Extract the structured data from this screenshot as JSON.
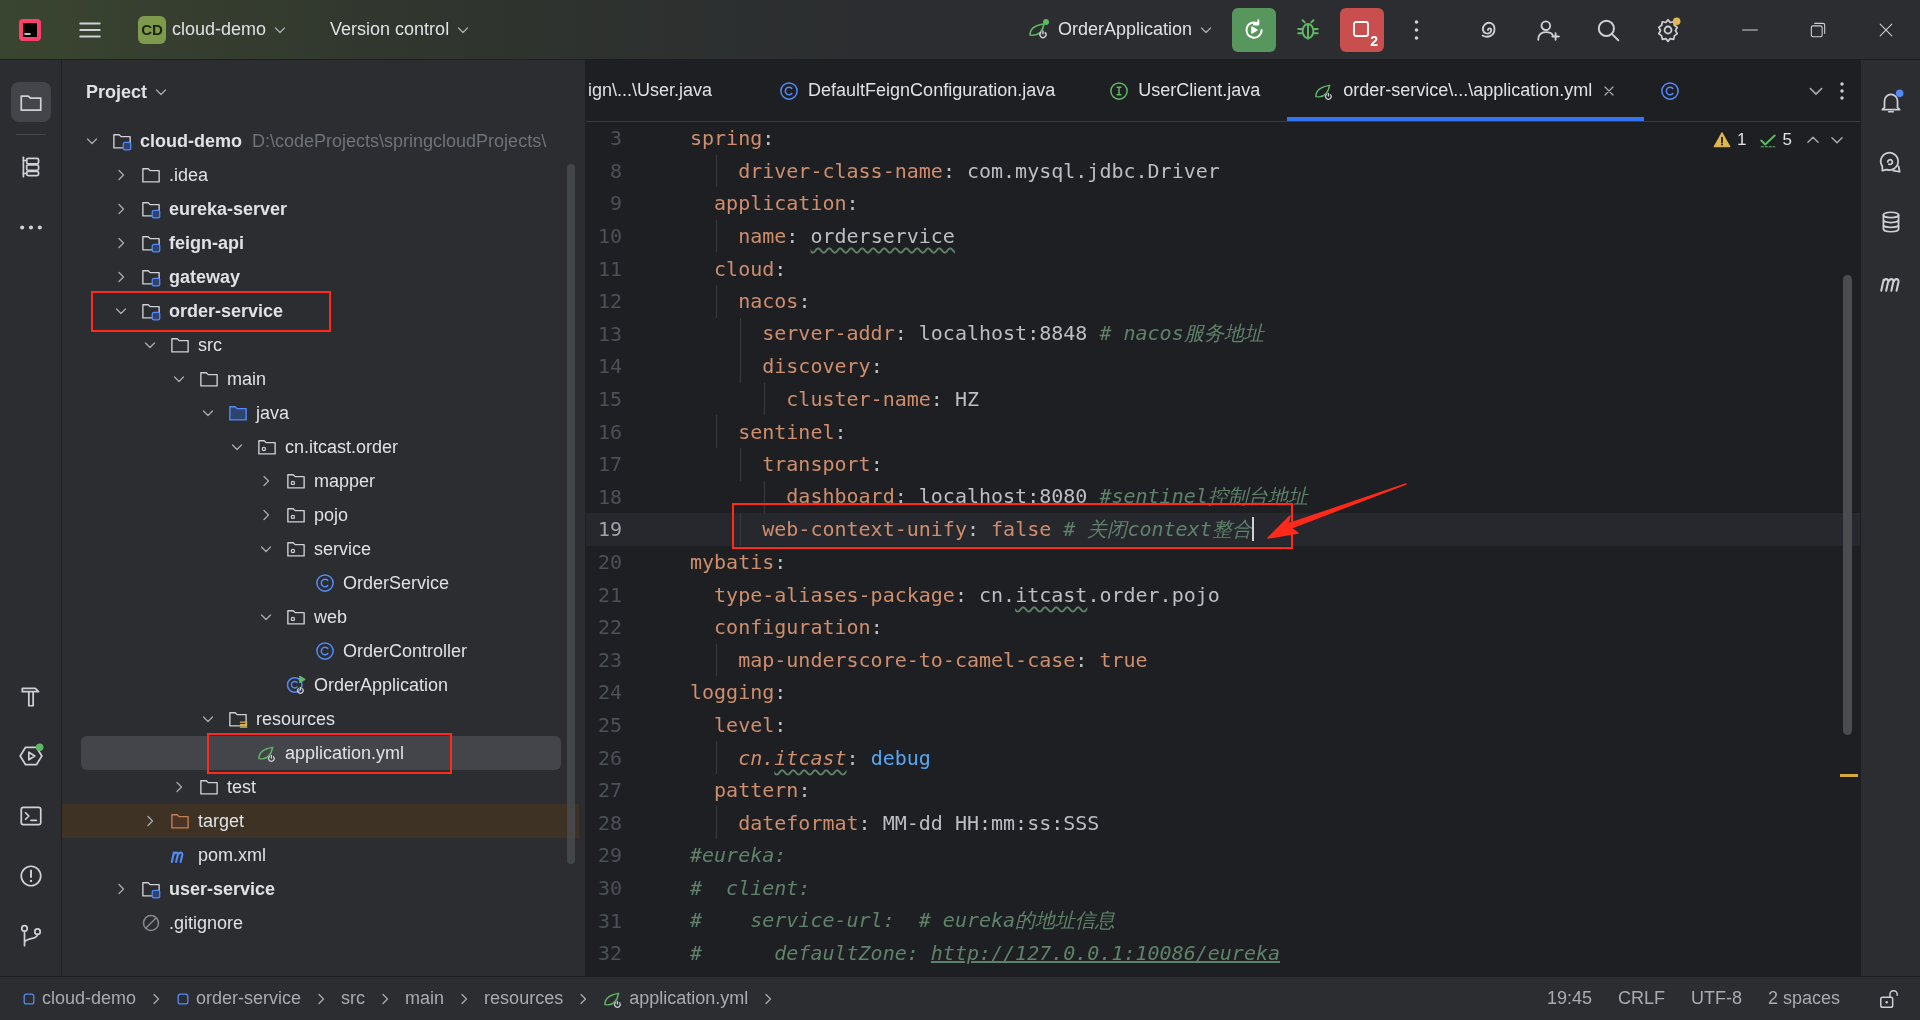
{
  "title_bar": {
    "project_badge": "CD",
    "project": "cloud-demo",
    "vcs": "Version control",
    "run_config": "OrderApplication",
    "stop_badge": "2",
    "settings_update": true
  },
  "left_toolbar": {
    "top": [
      {
        "kind": "project",
        "selected": true,
        "notify": false
      },
      {
        "kind": "structure",
        "selected": false,
        "notify": false
      },
      {
        "kind": "more",
        "selected": false,
        "notify": false
      }
    ],
    "bottom": [
      {
        "kind": "build",
        "selected": false,
        "notify": false
      },
      {
        "kind": "services",
        "selected": false,
        "notify": true
      },
      {
        "kind": "terminal",
        "selected": false,
        "notify": false
      },
      {
        "kind": "problems",
        "selected": false,
        "notify": false
      },
      {
        "kind": "git",
        "selected": false,
        "notify": false
      }
    ]
  },
  "project_panel": {
    "title": "Project",
    "tree": [
      {
        "label": "cloud-demo",
        "kind": "module",
        "bold": true,
        "path": "D:\\codeProjects\\springcloudProjects\\",
        "expanded": true,
        "selected": false,
        "annotated": false,
        "children": [
          {
            "label": ".idea",
            "kind": "folder",
            "bold": false,
            "expanded": false,
            "selected": false,
            "annotated": false
          },
          {
            "label": "eureka-server",
            "kind": "module",
            "bold": true,
            "expanded": false,
            "selected": false,
            "annotated": false
          },
          {
            "label": "feign-api",
            "kind": "module",
            "bold": true,
            "expanded": false,
            "selected": false,
            "annotated": false
          },
          {
            "label": "gateway",
            "kind": "module",
            "bold": true,
            "expanded": false,
            "selected": false,
            "annotated": false
          },
          {
            "label": "order-service",
            "kind": "module",
            "bold": true,
            "expanded": true,
            "selected": false,
            "annotated": true,
            "children": [
              {
                "label": "src",
                "kind": "folder",
                "bold": false,
                "expanded": true,
                "selected": false,
                "annotated": false,
                "children": [
                  {
                    "label": "main",
                    "kind": "folder",
                    "bold": false,
                    "expanded": true,
                    "selected": false,
                    "annotated": false,
                    "children": [
                      {
                        "label": "java",
                        "kind": "source",
                        "bold": false,
                        "expanded": true,
                        "selected": false,
                        "annotated": false,
                        "children": [
                          {
                            "label": "cn.itcast.order",
                            "kind": "package",
                            "bold": false,
                            "expanded": true,
                            "selected": false,
                            "annotated": false,
                            "children": [
                              {
                                "label": "mapper",
                                "kind": "package",
                                "bold": false,
                                "expanded": false,
                                "selected": false,
                                "annotated": false
                              },
                              {
                                "label": "pojo",
                                "kind": "package",
                                "bold": false,
                                "expanded": false,
                                "selected": false,
                                "annotated": false
                              },
                              {
                                "label": "service",
                                "kind": "package",
                                "bold": false,
                                "expanded": true,
                                "selected": false,
                                "annotated": false,
                                "children": [
                                  {
                                    "label": "OrderService",
                                    "kind": "class",
                                    "bold": false,
                                    "selected": false,
                                    "annotated": false
                                  }
                                ]
                              },
                              {
                                "label": "web",
                                "kind": "package",
                                "bold": false,
                                "expanded": true,
                                "selected": false,
                                "annotated": false,
                                "children": [
                                  {
                                    "label": "OrderController",
                                    "kind": "class",
                                    "bold": false,
                                    "selected": false,
                                    "annotated": false
                                  }
                                ]
                              },
                              {
                                "label": "OrderApplication",
                                "kind": "spring-class",
                                "bold": false,
                                "selected": false,
                                "annotated": false
                              }
                            ]
                          }
                        ]
                      },
                      {
                        "label": "resources",
                        "kind": "resources",
                        "bold": false,
                        "expanded": true,
                        "selected": false,
                        "annotated": false,
                        "children": [
                          {
                            "label": "application.yml",
                            "kind": "spring-config",
                            "bold": false,
                            "selected": true,
                            "annotated": true
                          }
                        ]
                      }
                    ]
                  },
                  {
                    "label": "test",
                    "kind": "folder",
                    "bold": false,
                    "expanded": false,
                    "selected": false,
                    "annotated": false
                  }
                ]
              },
              {
                "label": "target",
                "kind": "excluded",
                "bold": false,
                "expanded": false,
                "selected": false,
                "annotated": false
              },
              {
                "label": "pom.xml",
                "kind": "maven",
                "bold": false,
                "selected": false,
                "annotated": false
              }
            ]
          },
          {
            "label": "user-service",
            "kind": "module",
            "bold": true,
            "expanded": false,
            "selected": false,
            "annotated": false
          },
          {
            "label": ".gitignore",
            "kind": "ignore",
            "bold": false,
            "selected": false,
            "annotated": false
          }
        ]
      }
    ]
  },
  "editor": {
    "tabs": [
      {
        "label": "ign\\...\\User.java",
        "kind": "plain",
        "selected": false,
        "closable": false
      },
      {
        "label": "DefaultFeignConfiguration.java",
        "kind": "class",
        "selected": false,
        "closable": false
      },
      {
        "label": "UserClient.java",
        "kind": "interface",
        "selected": false,
        "closable": false
      },
      {
        "label": "order-service\\...\\application.yml",
        "kind": "spring-config",
        "selected": true,
        "closable": true
      },
      {
        "kind": "class",
        "selected": false,
        "closable": false
      }
    ],
    "inspections": {
      "warnings": "1",
      "passed": "5"
    },
    "lines": [
      {
        "number": "3",
        "current": false,
        "annotated": false,
        "segments": [
          {
            "kind": "key",
            "text": "spring"
          },
          {
            "kind": "plain",
            "text": ":"
          }
        ]
      },
      {
        "number": "8",
        "current": false,
        "annotated": false,
        "segments": [
          {
            "kind": "key",
            "text": "    driver-class-name"
          },
          {
            "kind": "plain",
            "text": ": com.mysql.jdbc.Driver"
          }
        ]
      },
      {
        "number": "9",
        "current": false,
        "annotated": false,
        "segments": [
          {
            "kind": "key",
            "text": "  application"
          },
          {
            "kind": "plain",
            "text": ":"
          }
        ]
      },
      {
        "number": "10",
        "current": false,
        "annotated": false,
        "segments": [
          {
            "kind": "key",
            "text": "    name"
          },
          {
            "kind": "plain",
            "text": ": "
          },
          {
            "kind": "plain",
            "text": "orderservice",
            "typo": true
          }
        ]
      },
      {
        "number": "11",
        "current": false,
        "annotated": false,
        "segments": [
          {
            "kind": "key",
            "text": "  cloud"
          },
          {
            "kind": "plain",
            "text": ":"
          }
        ]
      },
      {
        "number": "12",
        "current": false,
        "annotated": false,
        "segments": [
          {
            "kind": "key",
            "text": "    nacos"
          },
          {
            "kind": "plain",
            "text": ":"
          }
        ]
      },
      {
        "number": "13",
        "current": false,
        "annotated": false,
        "segments": [
          {
            "kind": "key",
            "text": "      server-addr"
          },
          {
            "kind": "plain",
            "text": ": localhost:8848 "
          },
          {
            "kind": "comment",
            "text": "# nacos服务地址"
          }
        ]
      },
      {
        "number": "14",
        "current": false,
        "annotated": false,
        "segments": [
          {
            "kind": "key",
            "text": "      discovery"
          },
          {
            "kind": "plain",
            "text": ":"
          }
        ]
      },
      {
        "number": "15",
        "current": false,
        "annotated": false,
        "segments": [
          {
            "kind": "key",
            "text": "        cluster-name"
          },
          {
            "kind": "plain",
            "text": ": HZ"
          }
        ]
      },
      {
        "number": "16",
        "current": false,
        "annotated": false,
        "segments": [
          {
            "kind": "key",
            "text": "    sentinel"
          },
          {
            "kind": "plain",
            "text": ":"
          }
        ]
      },
      {
        "number": "17",
        "current": false,
        "annotated": false,
        "segments": [
          {
            "kind": "key",
            "text": "      transport"
          },
          {
            "kind": "plain",
            "text": ":"
          }
        ]
      },
      {
        "number": "18",
        "current": false,
        "annotated": false,
        "segments": [
          {
            "kind": "key",
            "text": "        dashboard"
          },
          {
            "kind": "plain",
            "text": ": localhost:8080 "
          },
          {
            "kind": "comment",
            "text": "#sentinel控制台地址"
          }
        ]
      },
      {
        "number": "19",
        "current": true,
        "annotated": true,
        "segments": [
          {
            "kind": "key",
            "text": "      web-context-unify"
          },
          {
            "kind": "plain",
            "text": ": "
          },
          {
            "kind": "bool",
            "text": "false"
          },
          {
            "kind": "comment",
            "text": " # 关闭context整合"
          }
        ]
      },
      {
        "number": "20",
        "current": false,
        "annotated": false,
        "segments": [
          {
            "kind": "key",
            "text": "mybatis"
          },
          {
            "kind": "plain",
            "text": ":"
          }
        ]
      },
      {
        "number": "21",
        "current": false,
        "annotated": false,
        "segments": [
          {
            "kind": "key",
            "text": "  type-aliases-package"
          },
          {
            "kind": "plain",
            "text": ": cn."
          },
          {
            "kind": "plain",
            "text": "itcast",
            "typo": true
          },
          {
            "kind": "plain",
            "text": ".order.pojo"
          }
        ]
      },
      {
        "number": "22",
        "current": false,
        "annotated": false,
        "segments": [
          {
            "kind": "key",
            "text": "  configuration"
          },
          {
            "kind": "plain",
            "text": ":"
          }
        ]
      },
      {
        "number": "23",
        "current": false,
        "annotated": false,
        "segments": [
          {
            "kind": "key",
            "text": "    map-underscore-to-camel-case"
          },
          {
            "kind": "plain",
            "text": ": "
          },
          {
            "kind": "bool",
            "text": "true"
          }
        ]
      },
      {
        "number": "24",
        "current": false,
        "annotated": false,
        "segments": [
          {
            "kind": "key",
            "text": "logging"
          },
          {
            "kind": "plain",
            "text": ":"
          }
        ]
      },
      {
        "number": "25",
        "current": false,
        "annotated": false,
        "segments": [
          {
            "kind": "key",
            "text": "  level"
          },
          {
            "kind": "plain",
            "text": ":"
          }
        ]
      },
      {
        "number": "26",
        "current": false,
        "annotated": false,
        "segments": [
          {
            "kind": "italic-key",
            "text": "    cn."
          },
          {
            "kind": "italic-key",
            "text": "itcast",
            "typo": true
          },
          {
            "kind": "plain",
            "text": ": "
          },
          {
            "kind": "enum",
            "text": "debug"
          }
        ]
      },
      {
        "number": "27",
        "current": false,
        "annotated": false,
        "segments": [
          {
            "kind": "key",
            "text": "  pattern"
          },
          {
            "kind": "plain",
            "text": ":"
          }
        ]
      },
      {
        "number": "28",
        "current": false,
        "annotated": false,
        "segments": [
          {
            "kind": "key",
            "text": "    dateformat"
          },
          {
            "kind": "plain",
            "text": ": MM-dd HH:mm:ss:SSS"
          }
        ]
      },
      {
        "number": "29",
        "current": false,
        "annotated": false,
        "segments": [
          {
            "kind": "comment",
            "text": "#eureka:"
          }
        ]
      },
      {
        "number": "30",
        "current": false,
        "annotated": false,
        "segments": [
          {
            "kind": "comment",
            "text": "#  client:"
          }
        ]
      },
      {
        "number": "31",
        "current": false,
        "annotated": false,
        "segments": [
          {
            "kind": "comment",
            "text": "#    service-url:  # eureka的地址信息"
          }
        ]
      },
      {
        "number": "32",
        "current": false,
        "annotated": false,
        "segments": [
          {
            "kind": "comment",
            "text": "#      defaultZone: "
          },
          {
            "kind": "link",
            "text": "http://127.0.0.1:10086/eureka"
          }
        ]
      }
    ]
  },
  "right_toolbar": [
    {
      "kind": "notifications",
      "selected": false,
      "notify": true
    },
    {
      "kind": "ai-chat",
      "selected": false,
      "notify": false
    },
    {
      "kind": "database",
      "selected": false,
      "notify": false
    },
    {
      "kind": "maven",
      "selected": false,
      "notify": false
    }
  ],
  "status_bar": {
    "breadcrumbs": [
      {
        "label": "cloud-demo",
        "kind": "module"
      },
      {
        "label": "order-service",
        "kind": "module"
      },
      {
        "label": "src",
        "kind": "plain"
      },
      {
        "label": "main",
        "kind": "plain"
      },
      {
        "label": "resources",
        "kind": "plain"
      },
      {
        "label": "application.yml",
        "kind": "spring-config"
      }
    ],
    "items": [
      "19:45",
      "CRLF",
      "UTF-8",
      "2 spaces"
    ]
  }
}
